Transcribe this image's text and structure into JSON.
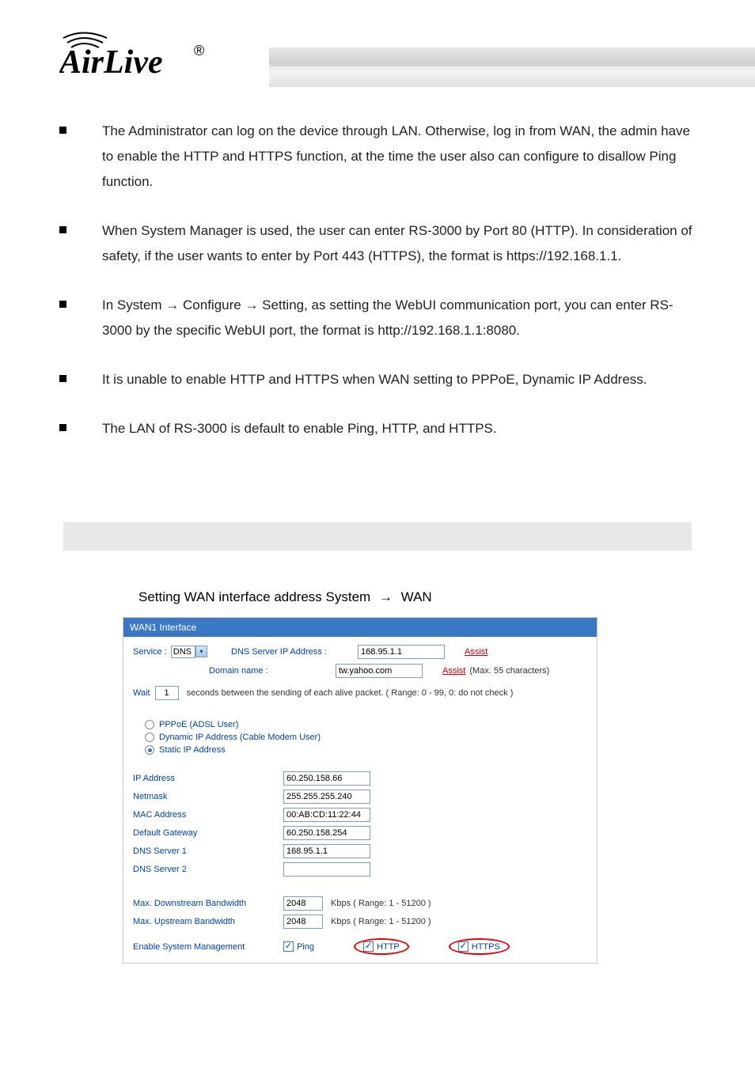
{
  "logo": {
    "name": "AirLive",
    "registered": "®"
  },
  "bullets": [
    "The Administrator can log on the device through LAN. Otherwise, log in from WAN, the admin have to enable the HTTP and HTTPS function, at the time the user also can configure to disallow Ping function.",
    "When System Manager is used, the user can enter RS-3000 by Port 80 (HTTP). In consideration of safety, if the user wants to enter by Port 443 (HTTPS), the format is https://192.168.1.1.",
    "In System → Configure → Setting, as setting the WebUI communication port, you can enter RS-3000 by the specific WebUI port, the format is http://192.168.1.1:8080.",
    "It is unable to enable HTTP and HTTPS when WAN setting to PPPoE, Dynamic IP Address.",
    "The LAN of RS-3000 is default to enable Ping, HTTP, and HTTPS."
  ],
  "instruction": {
    "prefix": "Setting WAN interface address System ",
    "arrowed": "WAN"
  },
  "wan": {
    "title": "WAN1 Interface",
    "serviceLabel": "Service :",
    "serviceValue": "DNS",
    "dnsIpLabel": "DNS Server IP Address :",
    "dnsIpValue": "168.95.1.1",
    "assist": "Assist",
    "domainLabel": "Domain name :",
    "domainValue": "tw.yahoo.com",
    "domainHint": "(Max. 55 characters)",
    "waitLabel": "Wait",
    "waitValue": "1",
    "waitHint": "seconds between the sending of each alive packet. ( Range: 0 - 99, 0: do not check )",
    "radios": [
      {
        "label": "PPPoE (ADSL User)",
        "checked": false
      },
      {
        "label": "Dynamic IP Address (Cable Modem User)",
        "checked": false
      },
      {
        "label": "Static IP Address",
        "checked": true
      }
    ],
    "fields": [
      {
        "label": "IP Address",
        "value": "60.250.158.66"
      },
      {
        "label": "Netmask",
        "value": "255.255.255.240"
      },
      {
        "label": "MAC Address",
        "value": "00:AB:CD:11:22:44"
      },
      {
        "label": "Default Gateway",
        "value": "60.250.158.254"
      },
      {
        "label": "DNS Server 1",
        "value": "168.95.1.1"
      },
      {
        "label": "DNS Server 2",
        "value": ""
      }
    ],
    "bw": [
      {
        "label": "Max. Downstream Bandwidth",
        "value": "2048",
        "hint": "Kbps  ( Range: 1 - 51200 )"
      },
      {
        "label": "Max. Upstream Bandwidth",
        "value": "2048",
        "hint": "Kbps  ( Range: 1 - 51200 )"
      }
    ],
    "mgmtLabel": "Enable System Management",
    "mgmtOpts": [
      {
        "name": "Ping",
        "circled": false
      },
      {
        "name": "HTTP",
        "circled": true
      },
      {
        "name": "HTTPS",
        "circled": true
      }
    ]
  }
}
